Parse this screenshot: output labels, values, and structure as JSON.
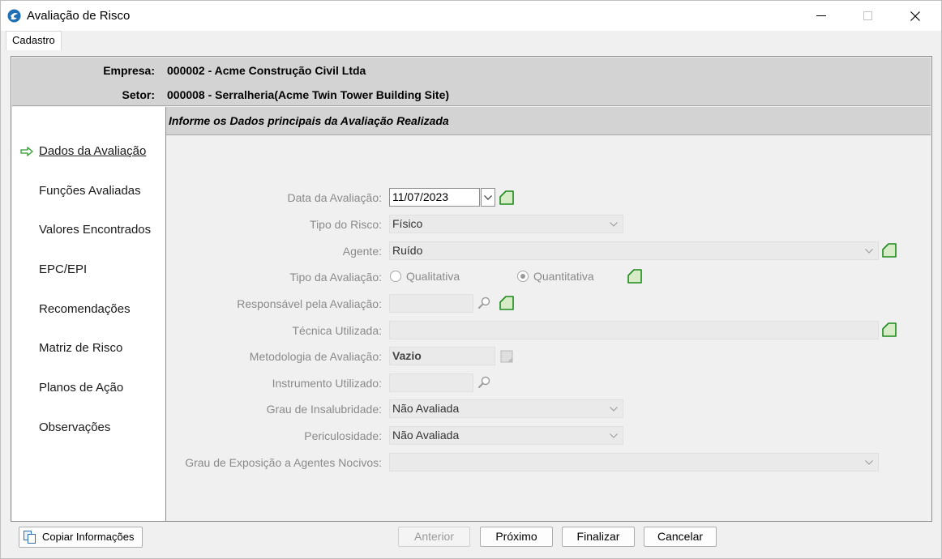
{
  "window": {
    "title": "Avaliação de Risco",
    "menu_tab": "Cadastro"
  },
  "header": {
    "empresa_label": "Empresa:",
    "empresa_value": "000002 - Acme Construção Civil Ltda",
    "setor_label": "Setor:",
    "setor_value": "000008 - Serralheria(Acme Twin Tower Building Site)"
  },
  "nav": {
    "items": [
      {
        "label": "Dados da Avaliação",
        "active": true
      },
      {
        "label": "Funções Avaliadas"
      },
      {
        "label": "Valores Encontrados"
      },
      {
        "label": "EPC/EPI"
      },
      {
        "label": "Recomendações"
      },
      {
        "label": "Matriz de Risco"
      },
      {
        "label": "Planos de Ação"
      },
      {
        "label": "Observações"
      }
    ]
  },
  "form": {
    "subtitle": "Informe os Dados principais da Avaliação Realizada",
    "data_avaliacao_label": "Data da Avaliação:",
    "data_avaliacao_value": "11/07/2023",
    "tipo_risco_label": "Tipo do Risco:",
    "tipo_risco_value": "Físico",
    "agente_label": "Agente:",
    "agente_value": "Ruído",
    "tipo_avaliacao_label": "Tipo da Avaliação:",
    "tipo_avaliacao_options": [
      "Qualitativa",
      "Quantitativa"
    ],
    "tipo_avaliacao_selected": "Quantitativa",
    "responsavel_label": "Responsável pela Avaliação:",
    "responsavel_value": "",
    "tecnica_label": "Técnica Utilizada:",
    "tecnica_value": "",
    "metodologia_label": "Metodologia de Avaliação:",
    "metodologia_value": "Vazio",
    "instrumento_label": "Instrumento Utilizado:",
    "instrumento_value": "",
    "grau_insalubridade_label": "Grau de Insalubridade:",
    "grau_insalubridade_value": "Não Avaliada",
    "periculosidade_label": "Periculosidade:",
    "periculosidade_value": "Não Avaliada",
    "grau_exposicao_label": "Grau de Exposição a Agentes Nocivos:",
    "grau_exposicao_value": ""
  },
  "footer": {
    "copy_label": "Copiar Informações",
    "anterior_label": "Anterior",
    "proximo_label": "Próximo",
    "finalizar_label": "Finalizar",
    "cancelar_label": "Cancelar"
  },
  "colors": {
    "accent_green": "#2e9a2e",
    "header_gray": "#d3d3d3",
    "disabled_text": "#8a8a8a"
  }
}
